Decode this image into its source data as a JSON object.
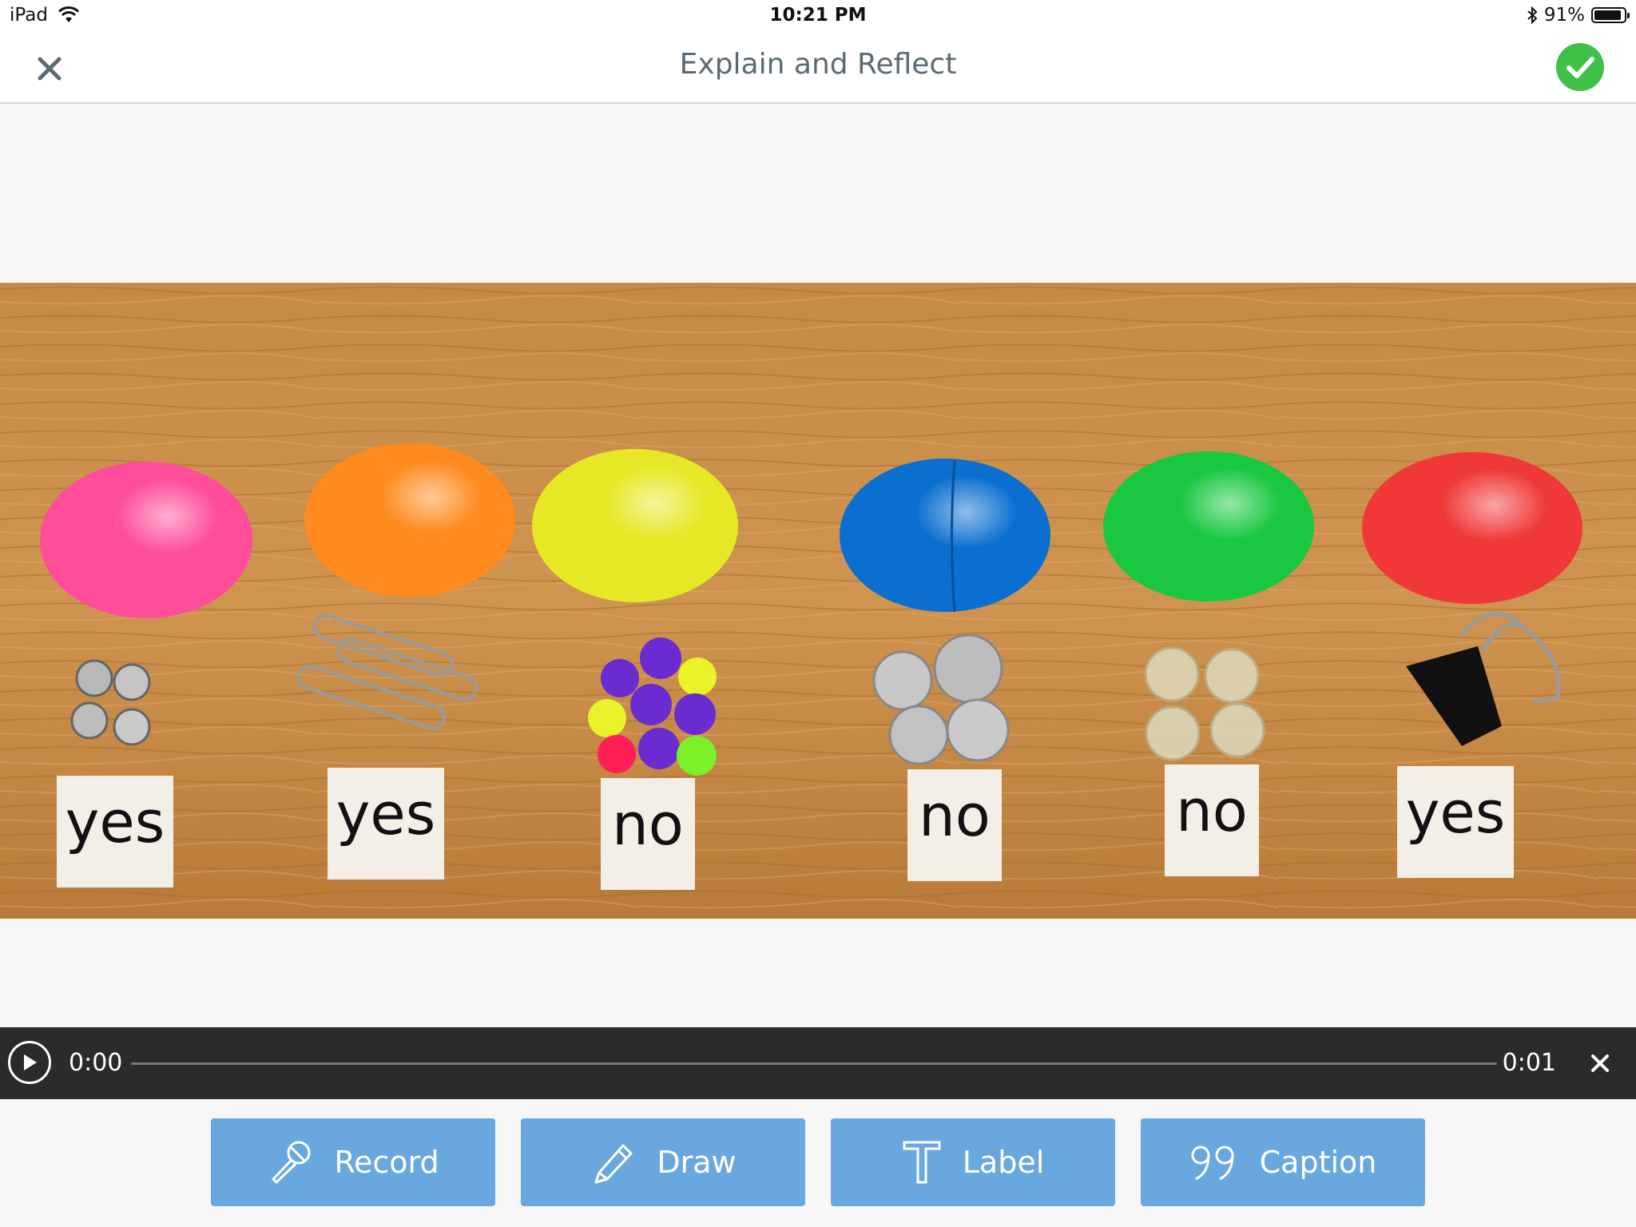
{
  "status_bar": {
    "device": "iPad",
    "time": "10:21 PM",
    "battery": "91%",
    "battery_level": 0.91
  },
  "navbar": {
    "title": "Explain and Reflect"
  },
  "photo": {
    "labels": [
      "yes",
      "yes",
      "no",
      "no",
      "no",
      "yes"
    ],
    "colors": {
      "egg_pink": "#ff4d9a",
      "egg_orange": "#ff8a1d",
      "egg_yellow": "#e6e825",
      "egg_blue": "#0b6fd0",
      "egg_green": "#19c840",
      "egg_red": "#f03838",
      "wood": "#c9893e"
    }
  },
  "player": {
    "current_time": "0:00",
    "duration": "0:01",
    "progress": 0
  },
  "toolbar": {
    "record": "Record",
    "draw": "Draw",
    "label": "Label",
    "caption": "Caption"
  },
  "colors": {
    "accent_button": "#69a7df",
    "done_green": "#3fc147",
    "player_bg": "#2b2b2b"
  }
}
